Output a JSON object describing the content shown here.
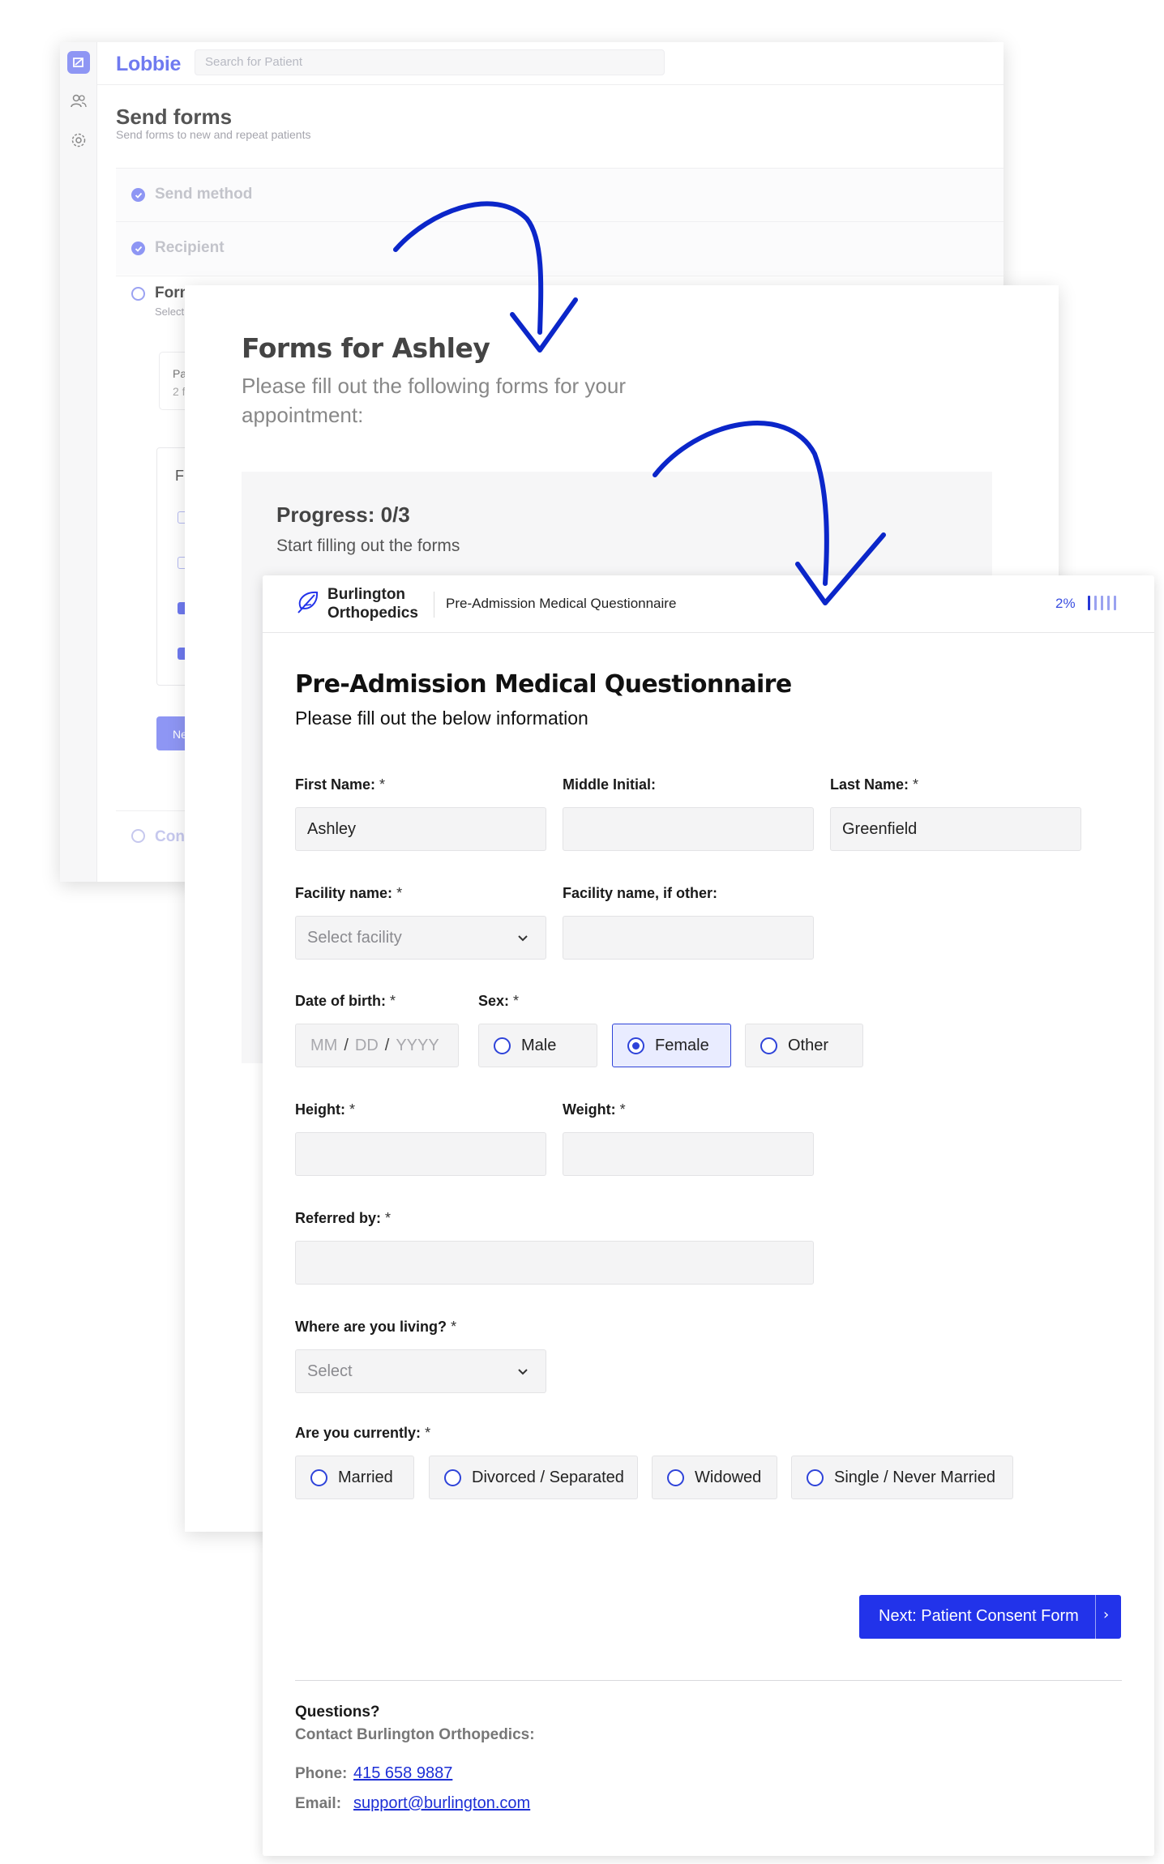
{
  "lobbie": {
    "brand": "Lobbie",
    "search_placeholder": "Search for Patient",
    "page_title": "Send forms",
    "page_subtitle": "Send forms to new and repeat patients",
    "steps": [
      {
        "label": "Send method"
      },
      {
        "label": "Recipient"
      },
      {
        "label": "Forms",
        "sub": "Select"
      },
      {
        "label": "Confirm"
      }
    ],
    "patient_card": {
      "line1": "Pat",
      "line2": "2 f"
    },
    "box_heading": "F",
    "next_label": "Ne"
  },
  "portal": {
    "title": "Forms for Ashley",
    "subtitle": "Please fill out the following forms for your appointment:",
    "progress_label": "Progress: 0/3",
    "progress_sub": "Start filling out the forms"
  },
  "questionnaire": {
    "org_line1": "Burlington",
    "org_line2": "Orthopedics",
    "form_name": "Pre-Admission Medical Questionnaire",
    "progress_pct": "2%",
    "progress_fraction": 0.02,
    "title": "Pre-Admission Medical Questionnaire",
    "subtitle": "Please fill out the below information",
    "fields": {
      "first_name": {
        "label": "First Name:",
        "value": "Ashley"
      },
      "middle_initial": {
        "label": "Middle Initial:",
        "value": ""
      },
      "last_name": {
        "label": "Last Name:",
        "value": "Greenfield"
      },
      "facility": {
        "label": "Facility name:",
        "placeholder": "Select facility"
      },
      "facility_other": {
        "label": "Facility name, if other:",
        "value": ""
      },
      "dob": {
        "label": "Date of birth:",
        "mm": "MM",
        "dd": "DD",
        "yyyy": "YYYY",
        "sep": "/"
      },
      "sex": {
        "label": "Sex:",
        "options": [
          "Male",
          "Female",
          "Other"
        ],
        "selected": "Female"
      },
      "height": {
        "label": "Height:",
        "value": ""
      },
      "weight": {
        "label": "Weight:",
        "value": ""
      },
      "referred_by": {
        "label": "Referred by:",
        "value": ""
      },
      "living": {
        "label": "Where are you living?",
        "placeholder": "Select"
      },
      "marital": {
        "label": "Are you currently:",
        "options": [
          "Married",
          "Divorced / Separated",
          "Widowed",
          "Single / Never Married"
        ],
        "selected": ""
      }
    },
    "required_mark": "*",
    "next_button": "Next: Patient Consent Form",
    "next_arrow": "›",
    "questions_heading": "Questions?",
    "contact_line": "Contact Burlington Orthopedics:",
    "phone_label": "Phone:",
    "phone": "415 658 9887",
    "email_label": "Email:",
    "email": "support@burlington.com"
  },
  "colors": {
    "lobbie_accent": "#6f7af0",
    "primary_blue": "#2233ea",
    "arrow_blue": "#0b26c9"
  }
}
